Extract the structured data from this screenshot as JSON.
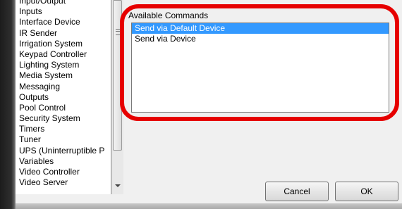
{
  "device_types": {
    "items": [
      "Input/Output",
      "Inputs",
      "Interface Device",
      "IR Sender",
      "Irrigation System",
      "Keypad Controller",
      "Lighting System",
      "Media System",
      "Messaging",
      "Outputs",
      "Pool Control",
      "Security System",
      "Timers",
      "Tuner",
      "UPS (Uninterruptible P",
      "Variables",
      "Video Controller",
      "Video Server"
    ]
  },
  "commands": {
    "label": "Available Commands",
    "items": [
      {
        "label": "Send via Default Device",
        "selected": true
      },
      {
        "label": "Send via Device",
        "selected": false
      }
    ]
  },
  "buttons": {
    "cancel": "Cancel",
    "ok": "OK"
  },
  "colors": {
    "selection": "#3399ff",
    "highlight_ring": "#e60000"
  },
  "icons": {
    "scroll_grip": "grip-icon",
    "scroll_down": "chevron-down-icon"
  }
}
